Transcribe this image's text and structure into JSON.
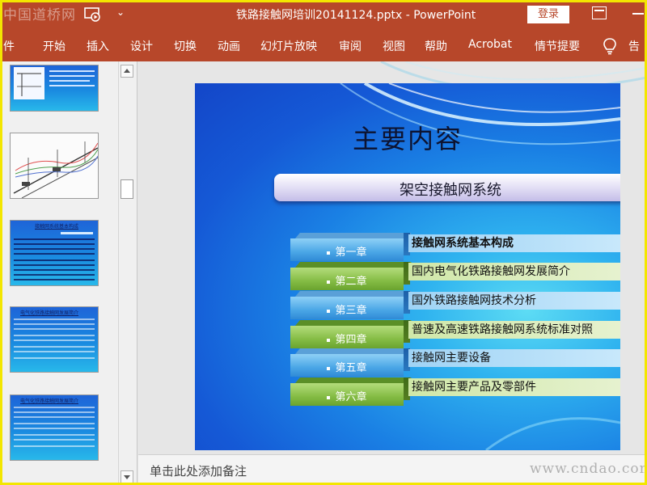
{
  "titlebar": {
    "watermark_logo": "中国道桥网",
    "qa_more": "⌄",
    "document_title": "铁路接触网培训20141124.pptx  -  PowerPoint",
    "login_label": "登录"
  },
  "ribbon": {
    "tabs": [
      "件",
      "开始",
      "插入",
      "设计",
      "切换",
      "动画",
      "幻灯片放映",
      "审阅",
      "视图",
      "帮助",
      "Acrobat",
      "情节提要"
    ],
    "tell_me": "告"
  },
  "thumbnails": {
    "slide3_title": "接触网系统基本构成",
    "slide4_title": "电气化铁路接触网发展简介",
    "slide5_title": "电气化铁路接触网发展简介"
  },
  "slide": {
    "title": "主要内容",
    "section": "架空接触网系统",
    "chapters": [
      {
        "label": "第一章",
        "desc": "接触网系统基本构成",
        "style": "blue",
        "bold": true
      },
      {
        "label": "第二章",
        "desc": "国内电气化铁路接触网发展简介",
        "style": "green",
        "bold": false
      },
      {
        "label": "第三章",
        "desc": "国外铁路接触网技术分析",
        "style": "blue",
        "bold": false
      },
      {
        "label": "第四章",
        "desc": "普速及高速铁路接触网系统标准对照",
        "style": "green",
        "bold": false
      },
      {
        "label": "第五章",
        "desc": "接触网主要设备",
        "style": "blue",
        "bold": false
      },
      {
        "label": "第六章",
        "desc": "接触网主要产品及零部件",
        "style": "green",
        "bold": false
      }
    ]
  },
  "notes": {
    "placeholder": "单击此处添加备注",
    "watermark": "www.cndao.com"
  },
  "colors": {
    "ribbon": "#b7472a",
    "frame": "#f3e600",
    "slide_blue": "#1559d6"
  }
}
